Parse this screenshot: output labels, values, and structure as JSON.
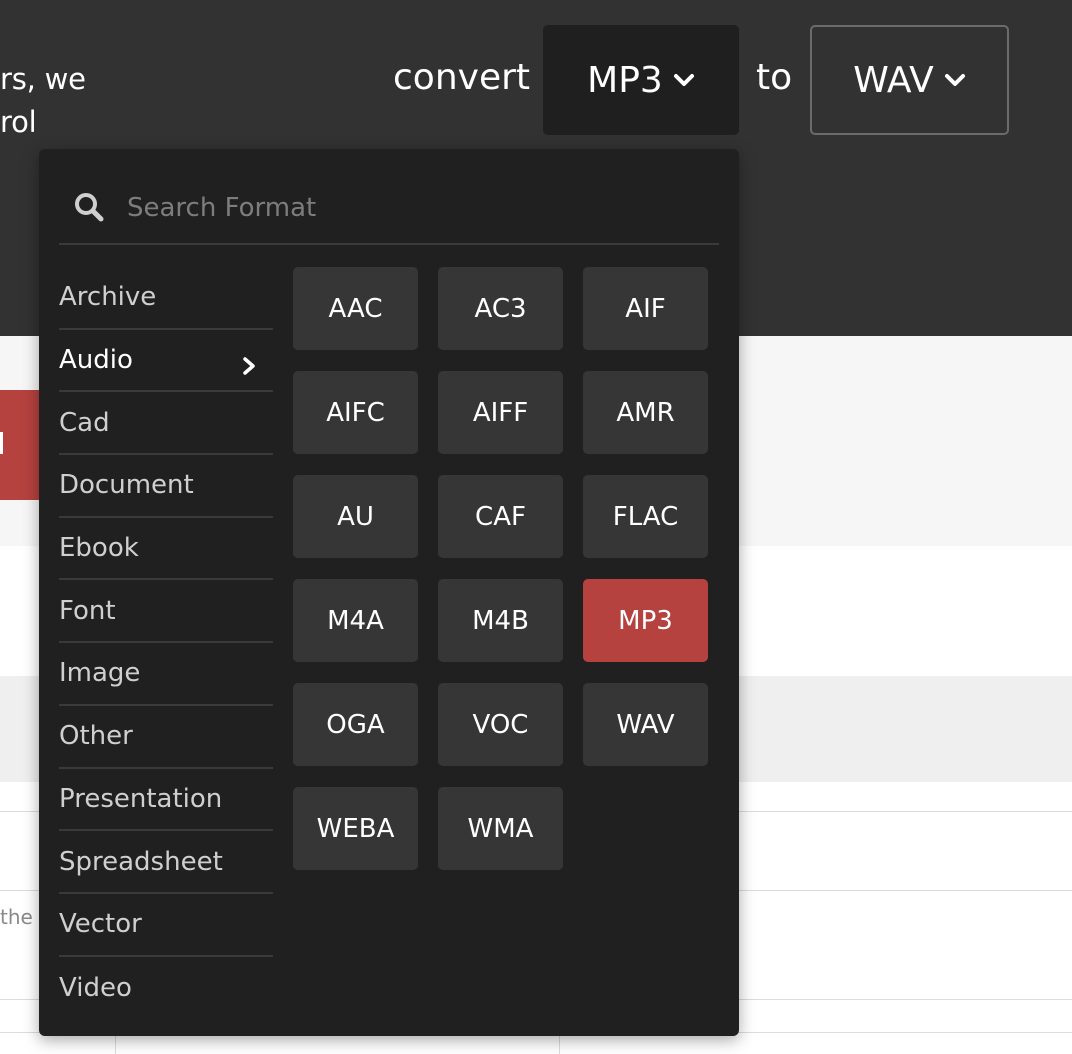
{
  "header": {
    "intro_line1": "rs, we",
    "intro_line2": "rol",
    "convert_label": "convert",
    "from_format": "MP3",
    "to_label": "to",
    "to_format": "WAV"
  },
  "behind": {
    "text": "the"
  },
  "dropdown": {
    "search_placeholder": "Search Format",
    "search_value": "",
    "categories": [
      {
        "label": "Archive",
        "active": false
      },
      {
        "label": "Audio",
        "active": true
      },
      {
        "label": "Cad",
        "active": false
      },
      {
        "label": "Document",
        "active": false
      },
      {
        "label": "Ebook",
        "active": false
      },
      {
        "label": "Font",
        "active": false
      },
      {
        "label": "Image",
        "active": false
      },
      {
        "label": "Other",
        "active": false
      },
      {
        "label": "Presentation",
        "active": false
      },
      {
        "label": "Spreadsheet",
        "active": false
      },
      {
        "label": "Vector",
        "active": false
      },
      {
        "label": "Video",
        "active": false
      }
    ],
    "formats": [
      {
        "label": "AAC",
        "selected": false
      },
      {
        "label": "AC3",
        "selected": false
      },
      {
        "label": "AIF",
        "selected": false
      },
      {
        "label": "AIFC",
        "selected": false
      },
      {
        "label": "AIFF",
        "selected": false
      },
      {
        "label": "AMR",
        "selected": false
      },
      {
        "label": "AU",
        "selected": false
      },
      {
        "label": "CAF",
        "selected": false
      },
      {
        "label": "FLAC",
        "selected": false
      },
      {
        "label": "M4A",
        "selected": false
      },
      {
        "label": "M4B",
        "selected": false
      },
      {
        "label": "MP3",
        "selected": true
      },
      {
        "label": "OGA",
        "selected": false
      },
      {
        "label": "VOC",
        "selected": false
      },
      {
        "label": "WAV",
        "selected": false
      },
      {
        "label": "WEBA",
        "selected": false
      },
      {
        "label": "WMA",
        "selected": false
      }
    ]
  },
  "colors": {
    "header_bg": "#323232",
    "dropdown_bg": "#202020",
    "format_button_bg": "#363636",
    "accent_selected": "#b5423f"
  },
  "icons": {
    "search": "search-icon",
    "dropdown_chevron": "chevron-down-icon",
    "category_arrow": "chevron-right-icon"
  }
}
